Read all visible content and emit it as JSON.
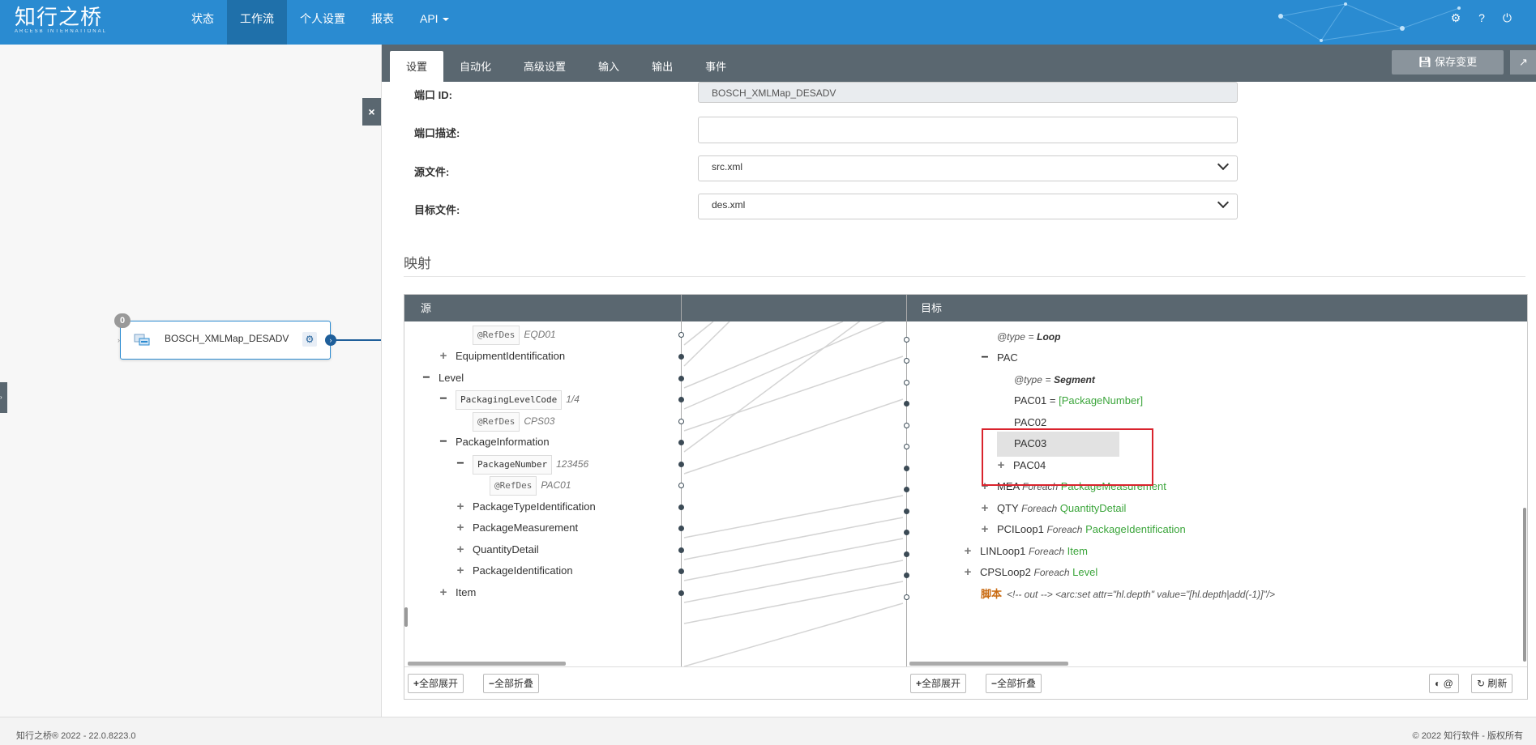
{
  "brand": {
    "name_cn": "知行之桥",
    "name_en": "ARCESB INTERNATIONAL"
  },
  "nav": [
    {
      "label": "状态"
    },
    {
      "label": "工作流"
    },
    {
      "label": "个人设置"
    },
    {
      "label": "报表"
    },
    {
      "label": "API"
    }
  ],
  "node": {
    "badge": "0",
    "label": "BOSCH_XMLMap_DESADV"
  },
  "tabs": [
    "设置",
    "自动化",
    "高级设置",
    "输入",
    "输出",
    "事件"
  ],
  "toolbar": {
    "save_label": "保存变更"
  },
  "form": {
    "port_id_label": "端口 ID:",
    "port_id_value": "BOSCH_XMLMap_DESADV",
    "port_desc_label": "端口描述:",
    "port_desc_value": "",
    "source_label": "源文件:",
    "source_value": "src.xml",
    "target_label": "目标文件:",
    "target_value": "des.xml"
  },
  "section_title": "映射",
  "mapper": {
    "source_header": "源",
    "target_header": "目标",
    "source_rows": [
      {
        "kind": "attr",
        "name": "@RefDes",
        "value": "EQD01"
      },
      {
        "kind": "node",
        "name": "EquipmentIdentification"
      },
      {
        "kind": "node",
        "name": "Level"
      },
      {
        "kind": "chip",
        "name": "PackagingLevelCode",
        "value": "1/4"
      },
      {
        "kind": "attr",
        "name": "@RefDes",
        "value": "CPS03"
      },
      {
        "kind": "node",
        "name": "PackageInformation"
      },
      {
        "kind": "chip",
        "name": "PackageNumber",
        "value": "123456"
      },
      {
        "kind": "attr",
        "name": "@RefDes",
        "value": "PAC01"
      },
      {
        "kind": "node",
        "name": "PackageTypeIdentification"
      },
      {
        "kind": "node",
        "name": "PackageMeasurement"
      },
      {
        "kind": "node",
        "name": "QuantityDetail"
      },
      {
        "kind": "node",
        "name": "PackageIdentification"
      },
      {
        "kind": "node",
        "name": "Item"
      }
    ],
    "target_rows": [
      {
        "name": "@type",
        "op": "=",
        "value": "Loop"
      },
      {
        "name": "PAC"
      },
      {
        "name": "@type",
        "op": "=",
        "value": "Segment"
      },
      {
        "name": "PAC01",
        "op": "=",
        "value": "[PackageNumber]"
      },
      {
        "name": "PAC02"
      },
      {
        "name": "PAC03"
      },
      {
        "name": "PAC04"
      },
      {
        "name": "MEA",
        "keyword": "Foreach",
        "value": "PackageMeasurement"
      },
      {
        "name": "QTY",
        "keyword": "Foreach",
        "value": "QuantityDetail"
      },
      {
        "name": "PCILoop1",
        "keyword": "Foreach",
        "value": "PackageIdentification"
      },
      {
        "name": "LINLoop1",
        "keyword": "Foreach",
        "value": "Item"
      },
      {
        "name": "CPSLoop2",
        "keyword": "Foreach",
        "value": "Level"
      },
      {
        "name": "脚本",
        "code": "<!-- out --> <arc:set attr=\"hl.depth\" value=\"[hl.depth|add(-1)]\"/>"
      }
    ],
    "expand_all": "全部展开",
    "collapse_all": "全部折叠",
    "refresh": "刷新"
  },
  "footer": {
    "left": "知行之桥® 2022 - 22.0.8223.0",
    "right": "© 2022 知行软件 - 版权所有"
  },
  "colors": {
    "topbar": "#2a8bd1",
    "tabbar": "#5a6770",
    "highlight": "#d9232d",
    "mapped": "#3ba53b"
  }
}
